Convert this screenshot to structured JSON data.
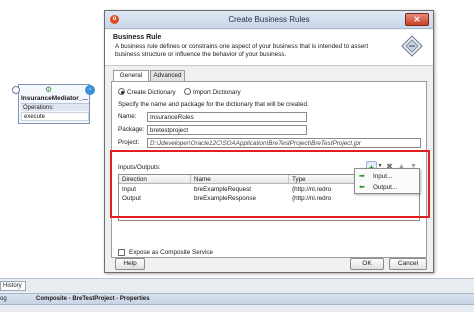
{
  "component": {
    "name": "InsuranceMediator_...",
    "operations_label": "Operations:",
    "operation": "execute"
  },
  "dialog": {
    "title": "Create Business Rules",
    "header_title": "Business Rule",
    "header_desc": "A business rule defines or constrains one aspect of your business that is intended to assert business structure or influence the behavior of your business.",
    "tabs": [
      {
        "label": "General"
      },
      {
        "label": "Advanced"
      }
    ],
    "create_dictionary": "Create Dictionary",
    "import_dictionary": "Import Dictionary",
    "instruction": "Specify the name and package for the dictionary that will be created.",
    "name_label": "Name:",
    "name_value": "InsuranceRules",
    "package_label": "Package:",
    "package_value": "bretestproject",
    "project_label": "Project:",
    "project_value": "D:\\Jdeveloper\\Oracle12C\\SOAApplication\\BreTestProject\\BreTestProject.jpr",
    "io_label": "Inputs/Outputs:",
    "io_columns": [
      "Direction",
      "Name",
      "Type"
    ],
    "io_rows": [
      {
        "direction": "Input",
        "name": "breExampleRequest",
        "type": "{http://nl.redro"
      },
      {
        "direction": "Output",
        "name": "breExampleResponse",
        "type": "{http://nl.redro"
      }
    ],
    "popup_items": [
      {
        "label": "Input..."
      },
      {
        "label": "Output..."
      }
    ],
    "expose_label": "Expose as Composite Service",
    "help_label": "Help",
    "ok_label": "OK",
    "cancel_label": "Cancel"
  },
  "bottom": {
    "history_tab": "History",
    "log_tab": "og",
    "properties_title": "Composite - BreTestProject - Properties"
  },
  "colors": {
    "highlight": "#e02020",
    "add_icon": "#1f9b2c"
  }
}
